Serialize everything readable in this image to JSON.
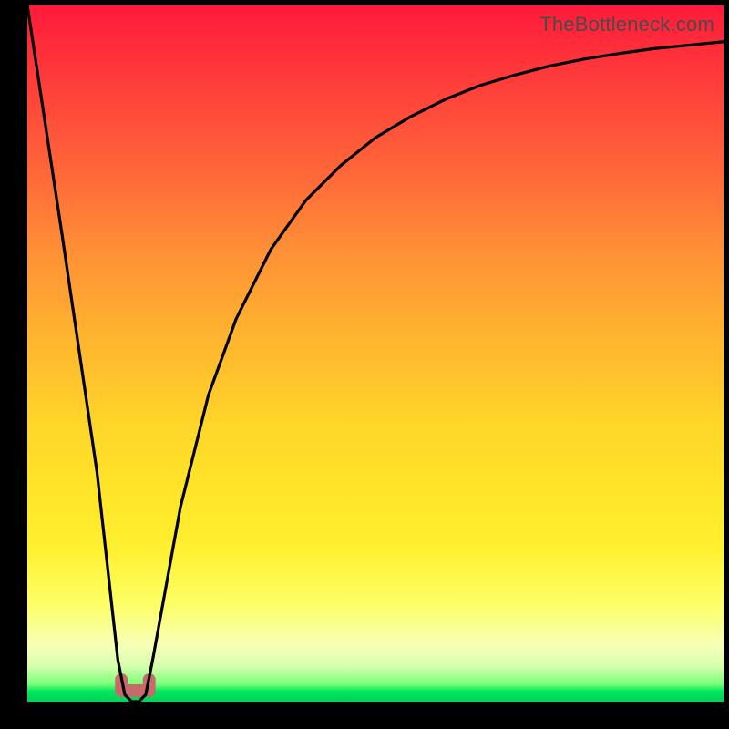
{
  "watermark": "TheBottleneck.com",
  "chart_data": {
    "type": "line",
    "title": "",
    "xlabel": "",
    "ylabel": "",
    "xlim": [
      0,
      100
    ],
    "ylim": [
      0,
      100
    ],
    "background_gradient": {
      "top_color": "#ff1a3a",
      "mid_color": "#ffe529",
      "bottom_color": "#00d257"
    },
    "series": [
      {
        "name": "bottleneck-curve",
        "x": [
          0,
          5,
          10,
          13,
          14,
          15,
          16,
          17,
          18,
          22,
          26,
          30,
          35,
          40,
          45,
          50,
          55,
          60,
          65,
          70,
          75,
          80,
          85,
          90,
          95,
          100
        ],
        "y": [
          100,
          67,
          33,
          6,
          1,
          0,
          0,
          1,
          6,
          28,
          44,
          55,
          65,
          72,
          77,
          81,
          84,
          86.5,
          88.5,
          90,
          91.3,
          92.3,
          93.1,
          93.8,
          94.3,
          94.8
        ]
      }
    ],
    "marker": {
      "name": "optimal-point",
      "x_range": [
        13.5,
        17.5
      ],
      "y": 0,
      "color": "#c96a6a"
    }
  }
}
